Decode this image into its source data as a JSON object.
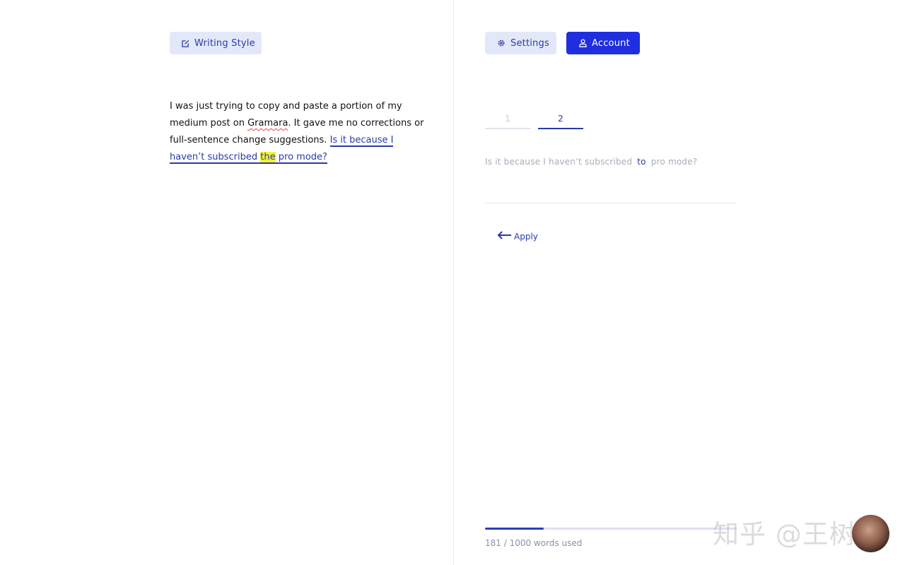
{
  "toolbar": {
    "writing_style_label": "Writing Style",
    "settings_label": "Settings",
    "account_label": "Account"
  },
  "editor": {
    "text_before": "I was just trying to copy and paste a portion of my medium post on ",
    "misspelled": "Gramara",
    "text_middle": ". It gave me no corrections or full-sentence change suggestions. ",
    "suggestion_before_highlight": "Is it because I haven’t subscribed ",
    "highlighted_word": "the",
    "suggestion_after_highlight": " pro mode?"
  },
  "suggestions_panel": {
    "tabs": [
      {
        "label": "1",
        "active": false
      },
      {
        "label": "2",
        "active": true
      }
    ],
    "text_before": "Is it because I haven’t subscribed",
    "inserted_word": "to",
    "text_after": "pro mode?",
    "apply_label": "Apply"
  },
  "usage": {
    "used": 181,
    "limit": 1000,
    "label": "181 / 1000 words used"
  },
  "watermark": {
    "text": "知乎 @王树义"
  },
  "colors": {
    "accent": "#1f2fe0",
    "link": "#2a3aa8",
    "highlight": "#f2f233",
    "button_light_bg": "#e3e8f9"
  }
}
